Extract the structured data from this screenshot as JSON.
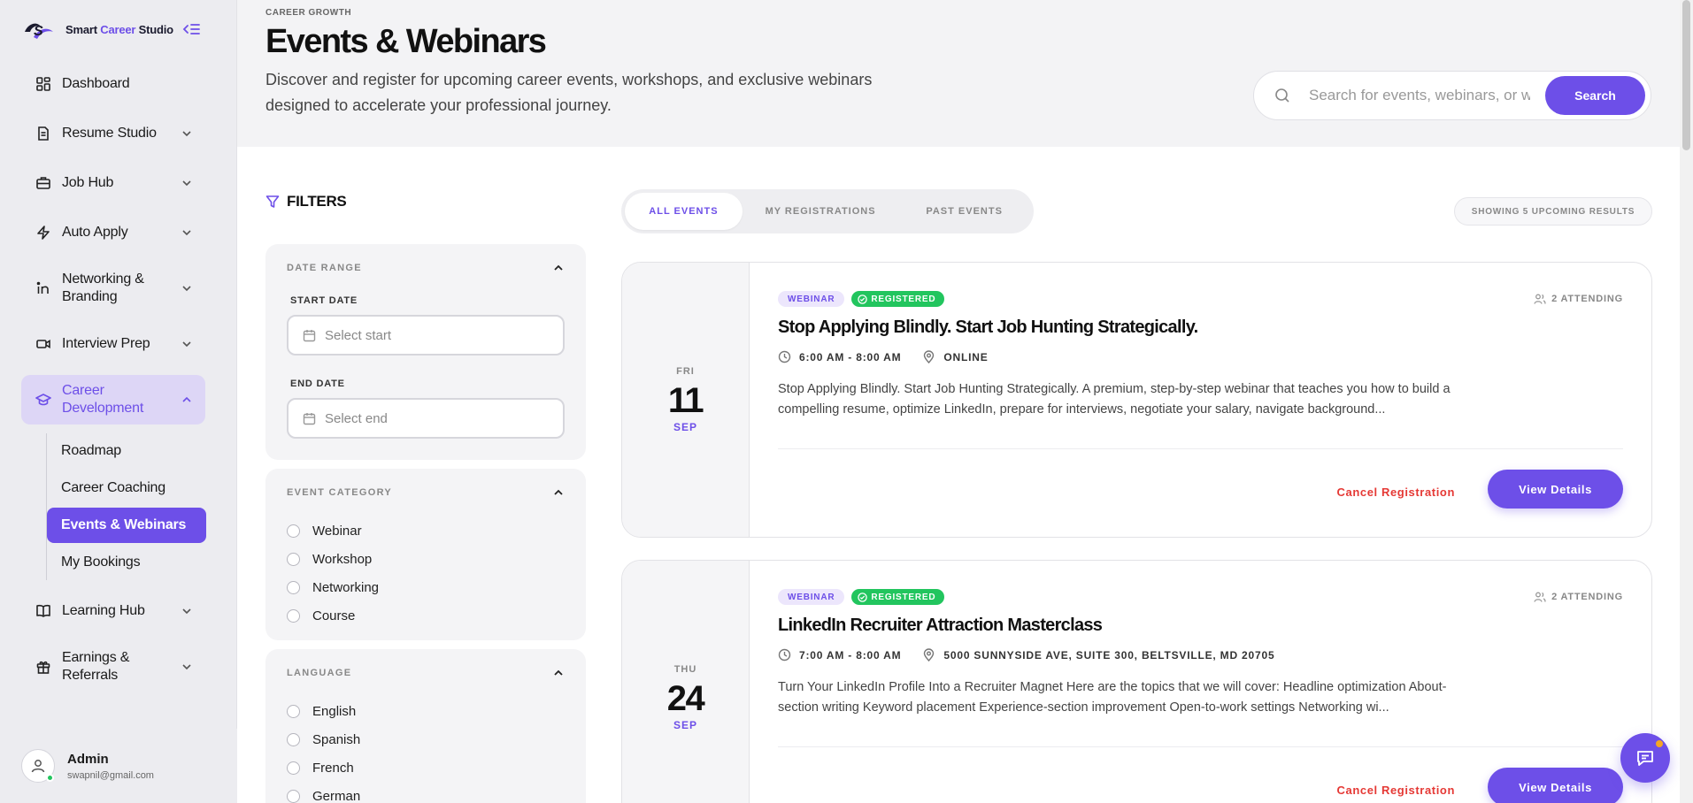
{
  "brand": {
    "name_prefix": "Smart ",
    "name_accent": "Career",
    "name_suffix": " Studio"
  },
  "sidebar": {
    "items": [
      {
        "label": "Dashboard",
        "icon": "dashboard-icon"
      },
      {
        "label": "Resume Studio",
        "icon": "document-icon"
      },
      {
        "label": "Job Hub",
        "icon": "briefcase-icon"
      },
      {
        "label": "Auto Apply",
        "icon": "bolt-icon"
      },
      {
        "label": "Networking & Branding",
        "icon": "linkedin-icon"
      },
      {
        "label": "Interview Prep",
        "icon": "video-icon"
      },
      {
        "label": "Career Development",
        "icon": "graduation-cap-icon"
      },
      {
        "label": "Learning Hub",
        "icon": "book-icon"
      },
      {
        "label": "Earnings & Referrals",
        "icon": "gift-icon"
      }
    ],
    "sub_items": [
      {
        "label": "Roadmap"
      },
      {
        "label": "Career Coaching"
      },
      {
        "label": "Events & Webinars"
      },
      {
        "label": "My Bookings"
      }
    ]
  },
  "profile": {
    "name": "Admin",
    "email": "swapnil@gmail.com"
  },
  "header": {
    "eyebrow": "CAREER GROWTH",
    "title": "Events & Webinars",
    "description": "Discover and register for upcoming career events, workshops, and exclusive webinars designed to accelerate your professional journey."
  },
  "search": {
    "placeholder": "Search for events, webinars, or w",
    "button": "Search"
  },
  "filters": {
    "title": "FILTERS",
    "date_range": {
      "heading": "DATE RANGE",
      "start_label": "START DATE",
      "start_placeholder": "Select start",
      "end_label": "END DATE",
      "end_placeholder": "Select end"
    },
    "category": {
      "heading": "EVENT CATEGORY",
      "options": [
        "Webinar",
        "Workshop",
        "Networking",
        "Course"
      ]
    },
    "language": {
      "heading": "LANGUAGE",
      "options": [
        "English",
        "Spanish",
        "French",
        "German"
      ]
    }
  },
  "tabs": [
    {
      "label": "ALL EVENTS",
      "active": true
    },
    {
      "label": "MY REGISTRATIONS",
      "active": false
    },
    {
      "label": "PAST EVENTS",
      "active": false
    }
  ],
  "results_text": "SHOWING 5 UPCOMING RESULTS",
  "events": [
    {
      "dow": "FRI",
      "day": "11",
      "month": "SEP",
      "type": "WEBINAR",
      "status": "REGISTERED",
      "attending": "2 ATTENDING",
      "title": "Stop Applying Blindly. Start Job Hunting Strategically.",
      "time": "6:00 AM - 8:00 AM",
      "location": "ONLINE",
      "description": "Stop Applying Blindly. Start Job Hunting Strategically. A premium, step-by-step webinar that teaches you how to build a compelling resume, optimize LinkedIn, prepare for interviews, negotiate your salary, navigate background...",
      "cancel_label": "Cancel Registration",
      "details_label": "View Details"
    },
    {
      "dow": "THU",
      "day": "24",
      "month": "SEP",
      "type": "WEBINAR",
      "status": "REGISTERED",
      "attending": "2 ATTENDING",
      "title": "LinkedIn Recruiter Attraction Masterclass",
      "time": "7:00 AM - 8:00 AM",
      "location": "5000 SUNNYSIDE AVE, SUITE 300, BELTSVILLE, MD 20705",
      "description": "Turn Your LinkedIn Profile Into a Recruiter Magnet Here are the topics that we will cover: Headline optimization About-section writing Keyword placement Experience-section improvement Open-to-work settings Networking wi...",
      "cancel_label": "Cancel Registration",
      "details_label": "View Details"
    }
  ],
  "colors": {
    "accent": "#6d4fe8",
    "success": "#22c55e",
    "danger": "#e53935"
  }
}
